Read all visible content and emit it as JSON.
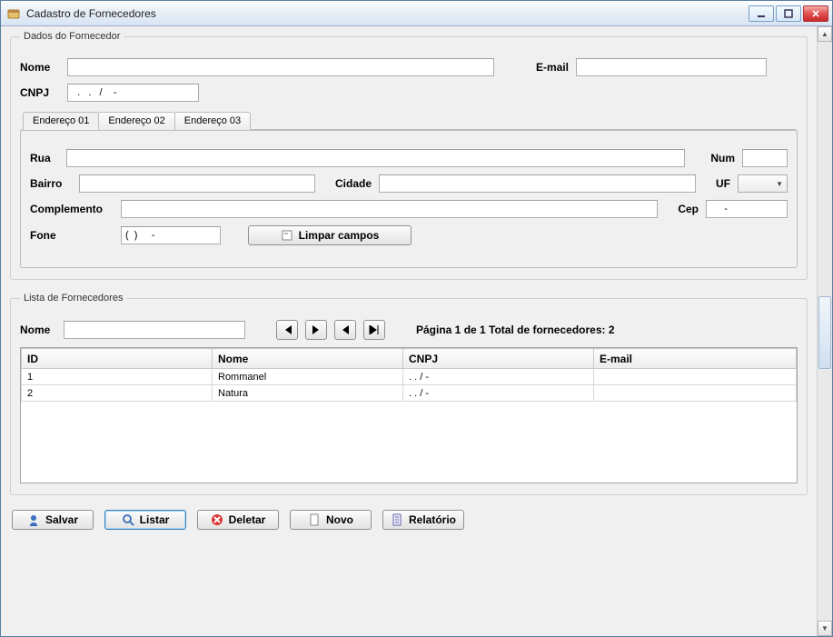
{
  "window": {
    "title": "Cadastro de Fornecedores"
  },
  "group_dados": {
    "legend": "Dados do Fornecedor",
    "nome_label": "Nome",
    "nome_value": "",
    "email_label": "E-mail",
    "email_value": "",
    "cnpj_label": "CNPJ",
    "cnpj_value": "  .   .   /    -"
  },
  "tabs": {
    "labels": [
      "Endereço 01",
      "Endereço 02",
      "Endereço 03"
    ],
    "active_index": 0,
    "rua_label": "Rua",
    "rua_value": "",
    "num_label": "Num",
    "num_value": "",
    "bairro_label": "Bairro",
    "bairro_value": "",
    "cidade_label": "Cidade",
    "cidade_value": "",
    "uf_label": "UF",
    "uf_value": "",
    "complemento_label": "Complemento",
    "complemento_value": "",
    "cep_label": "Cep",
    "cep_value": "     -",
    "fone_label": "Fone",
    "fone_value": "(  )     -",
    "limpar_label": "Limpar campos"
  },
  "lista": {
    "legend": "Lista de Fornecedores",
    "nome_search_label": "Nome",
    "nome_search_value": "",
    "status": "Página 1 de 1  Total de fornecedores: 2",
    "columns": [
      "ID",
      "Nome",
      "CNPJ",
      "E-mail"
    ],
    "rows": [
      {
        "id": "1",
        "nome": "Rommanel",
        "cnpj": "  .   .   /    -",
        "email": ""
      },
      {
        "id": "2",
        "nome": "Natura",
        "cnpj": "  .   .   /    -",
        "email": ""
      }
    ]
  },
  "actions": {
    "salvar": "Salvar",
    "listar": "Listar",
    "deletar": "Deletar",
    "novo": "Novo",
    "relatorio": "Relatório"
  }
}
